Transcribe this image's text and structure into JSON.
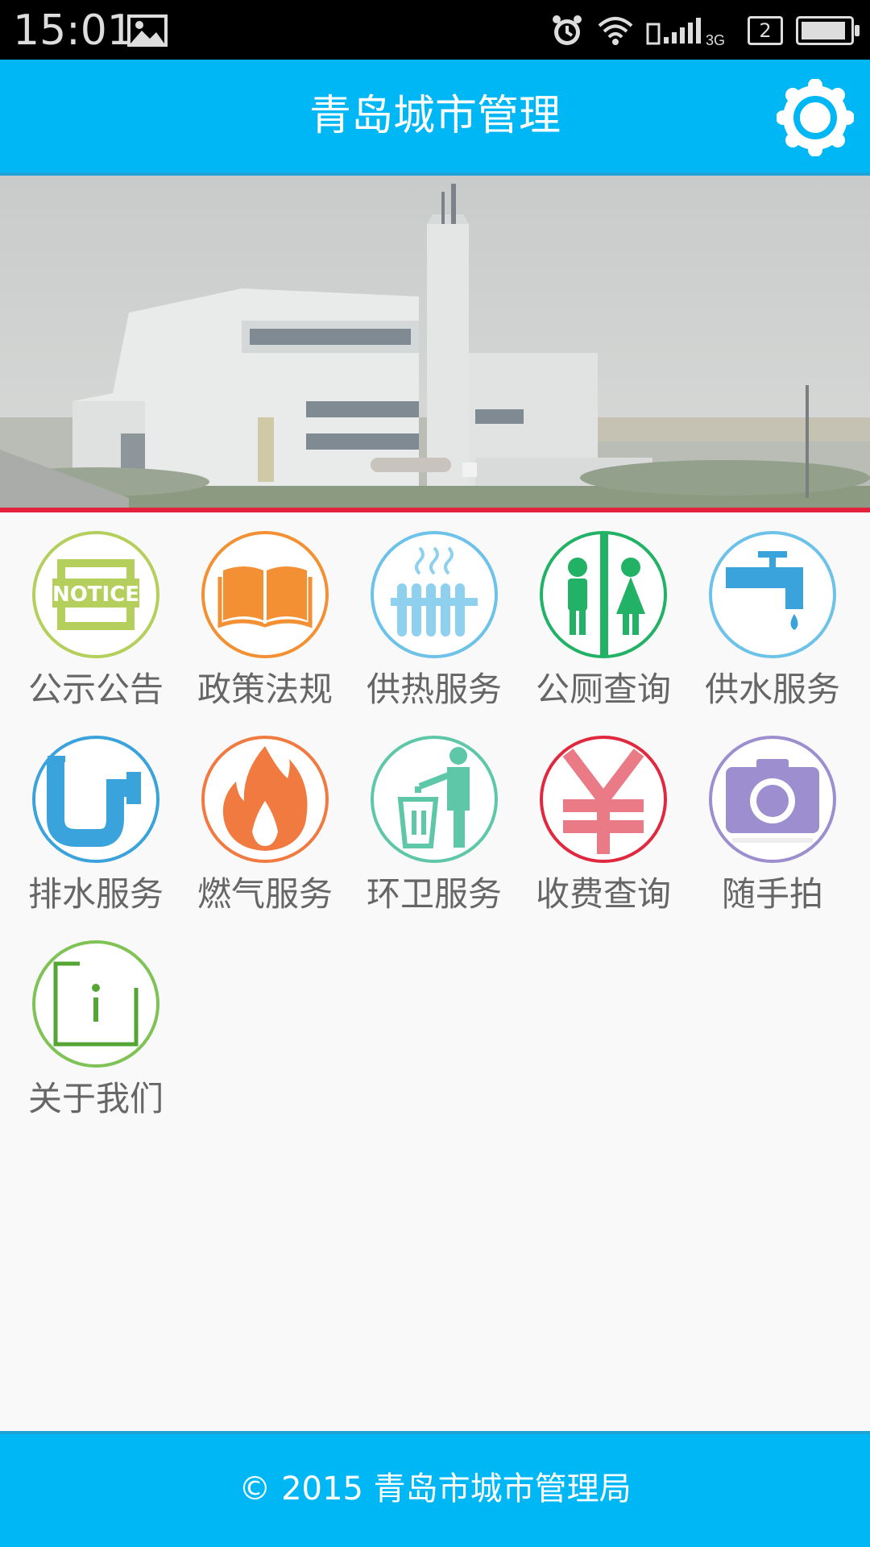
{
  "status_bar": {
    "time": "15:01",
    "sim": "2",
    "network": "3G"
  },
  "header": {
    "title": "青岛城市管理"
  },
  "grid": [
    {
      "label": "公示公告",
      "badge_text": "NOTICE"
    },
    {
      "label": "政策法规"
    },
    {
      "label": "供热服务"
    },
    {
      "label": "公厕查询"
    },
    {
      "label": "供水服务"
    },
    {
      "label": "排水服务"
    },
    {
      "label": "燃气服务"
    },
    {
      "label": "环卫服务"
    },
    {
      "label": "收费查询"
    },
    {
      "label": "随手拍"
    },
    {
      "label": "关于我们"
    }
  ],
  "footer": {
    "text": "© 2015 青岛市城市管理局"
  },
  "colors": {
    "header": "#00b7f5",
    "banner_underline": "#e5223b",
    "label": "#666666"
  },
  "icons": [
    "notice-icon",
    "book-icon",
    "radiator-icon",
    "toilet-icon",
    "faucet-icon",
    "drain-pipe-icon",
    "flame-icon",
    "trash-bin-icon",
    "yen-icon",
    "camera-icon",
    "info-icon"
  ]
}
